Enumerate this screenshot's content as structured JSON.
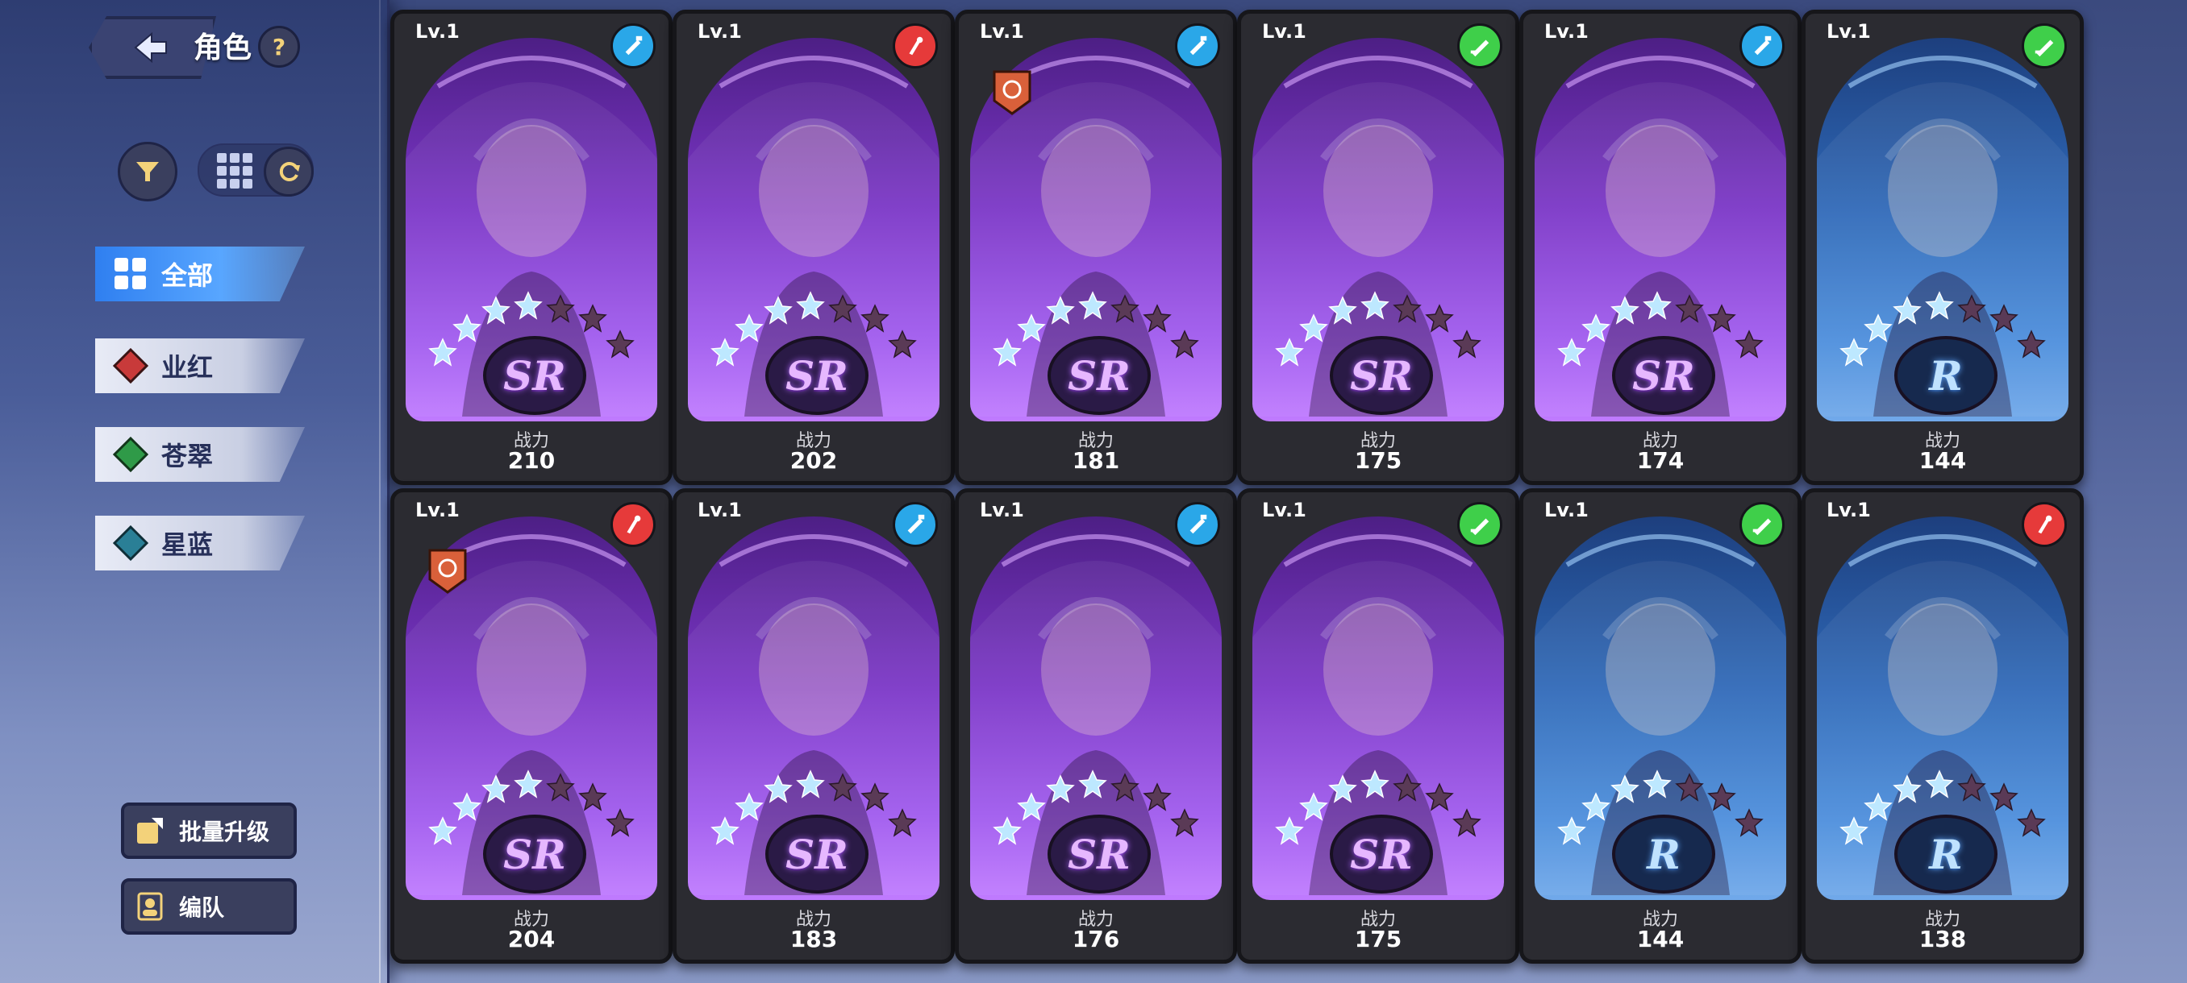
{
  "header": {
    "title": "角色",
    "help": "?"
  },
  "tabs": [
    {
      "label": "全部",
      "active": true,
      "color": "#2f7ff0"
    },
    {
      "label": "业红",
      "active": false,
      "color": "#c83a3a"
    },
    {
      "label": "苍翠",
      "active": false,
      "color": "#2f9a48"
    },
    {
      "label": "星蓝",
      "active": false,
      "color": "#2a7f96"
    }
  ],
  "buttons": {
    "batch_upgrade": "批量升级",
    "formation": "编队"
  },
  "power_label": "战力",
  "cards": [
    {
      "level": "Lv.1",
      "rarity": "SR",
      "power": "210",
      "element": "blue"
    },
    {
      "level": "Lv.1",
      "rarity": "SR",
      "power": "202",
      "element": "red"
    },
    {
      "level": "Lv.1",
      "rarity": "SR",
      "power": "181",
      "element": "blue"
    },
    {
      "level": "Lv.1",
      "rarity": "SR",
      "power": "175",
      "element": "green"
    },
    {
      "level": "Lv.1",
      "rarity": "SR",
      "power": "174",
      "element": "blue"
    },
    {
      "level": "Lv.1",
      "rarity": "R",
      "power": "144",
      "element": "green"
    },
    {
      "level": "Lv.1",
      "rarity": "SR",
      "power": "204",
      "element": "red"
    },
    {
      "level": "Lv.1",
      "rarity": "SR",
      "power": "183",
      "element": "blue"
    },
    {
      "level": "Lv.1",
      "rarity": "SR",
      "power": "176",
      "element": "blue"
    },
    {
      "level": "Lv.1",
      "rarity": "SR",
      "power": "175",
      "element": "green"
    },
    {
      "level": "Lv.1",
      "rarity": "R",
      "power": "144",
      "element": "green"
    },
    {
      "level": "Lv.1",
      "rarity": "R",
      "power": "138",
      "element": "red"
    }
  ],
  "colors": {
    "sr_accent": "#a25cf0",
    "r_accent": "#4d8fdd",
    "active_tab": "#2f7ff0"
  }
}
